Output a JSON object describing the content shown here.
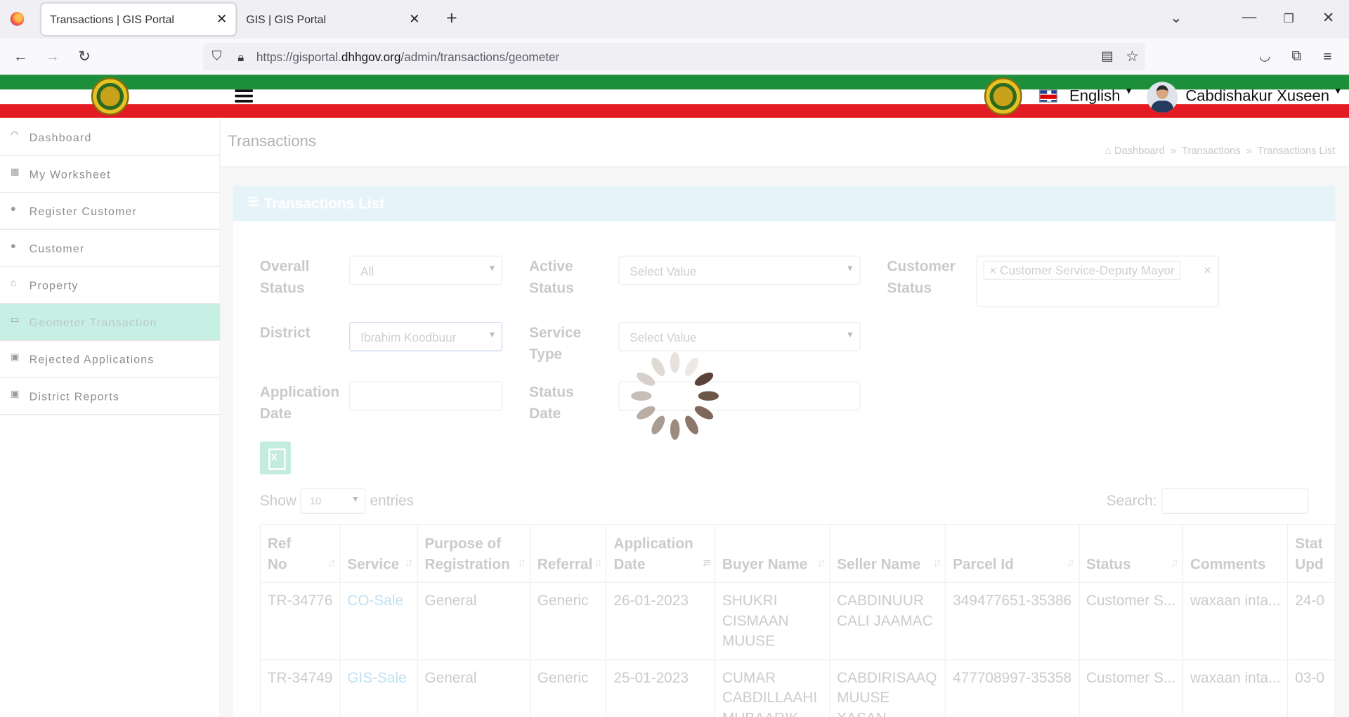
{
  "browser": {
    "tabs": [
      {
        "title": "Transactions | GIS Portal",
        "active": true
      },
      {
        "title": "GIS | GIS Portal",
        "active": false
      }
    ],
    "url_prefix": "https://gisportal.",
    "url_domain": "dhhgov.org",
    "url_path": "/admin/transactions/geometer"
  },
  "header": {
    "language": "English",
    "user_name": "Cabdishakur Xuseen"
  },
  "sidebar": {
    "items": [
      {
        "label": "Dashboard",
        "icon": "gauge-icon"
      },
      {
        "label": "My Worksheet",
        "icon": "worksheet-icon"
      },
      {
        "label": "Register Customer",
        "icon": "user-icon"
      },
      {
        "label": "Customer",
        "icon": "user-icon"
      },
      {
        "label": "Property",
        "icon": "home-icon"
      },
      {
        "label": "Geometer Transaction",
        "icon": "map-icon",
        "active": true
      },
      {
        "label": "Rejected Applications",
        "icon": "document-icon"
      },
      {
        "label": "District Reports",
        "icon": "report-icon"
      }
    ]
  },
  "page": {
    "title": "Transactions",
    "breadcrumb": [
      "Dashboard",
      "Transactions",
      "Transactions List"
    ],
    "card_title": "Transactions List"
  },
  "filters": {
    "overall_status": {
      "label": "Overall Status",
      "value": "All"
    },
    "active_status": {
      "label": "Active Status",
      "placeholder": "Select Value"
    },
    "customer_status": {
      "label": "Customer Status",
      "chip": "Customer Service-Deputy Mayor"
    },
    "district": {
      "label": "District",
      "value": "Ibrahim Koodbuur"
    },
    "service_type": {
      "label": "Service Type",
      "placeholder": "Select Value"
    },
    "application_date": {
      "label": "Application Date",
      "value": ""
    },
    "status_date": {
      "label": "Status Date",
      "value": ""
    }
  },
  "table_controls": {
    "show_label": "Show",
    "page_size": "10",
    "entries_label": "entries",
    "search_label": "Search:"
  },
  "table": {
    "columns": [
      "Ref No",
      "Service",
      "Purpose of Registration",
      "Referral",
      "Application Date",
      "Buyer Name",
      "Seller Name",
      "Parcel Id",
      "Status",
      "Comments",
      "Stat Upd"
    ],
    "rows": [
      {
        "ref": "TR-34776",
        "service": "CO-Sale",
        "purpose": "General",
        "referral": "Generic",
        "app_date": "26-01-2023",
        "buyer": "SHUKRI CISMAAN MUUSE",
        "seller": "CABDINUUR CALI JAAMAC",
        "parcel": "349477651-35386",
        "status": "Customer S...",
        "comments": "waxaan inta...",
        "stat_upd": "24-0"
      },
      {
        "ref": "TR-34749",
        "service": "GIS-Sale",
        "purpose": "General",
        "referral": "Generic",
        "app_date": "25-01-2023",
        "buyer": "CUMAR CABDILLAAHI MUBAARIK",
        "seller": "CABDIRISAAQ MUUSE XASAN",
        "parcel": "477708997-35358",
        "status": "Customer S...",
        "comments": "waxaan inta...",
        "stat_upd": "03-0"
      }
    ]
  },
  "colors": {
    "header_green": "#1d8f3a",
    "header_red": "#e31b23",
    "sidebar_active": "#c8efe4"
  }
}
